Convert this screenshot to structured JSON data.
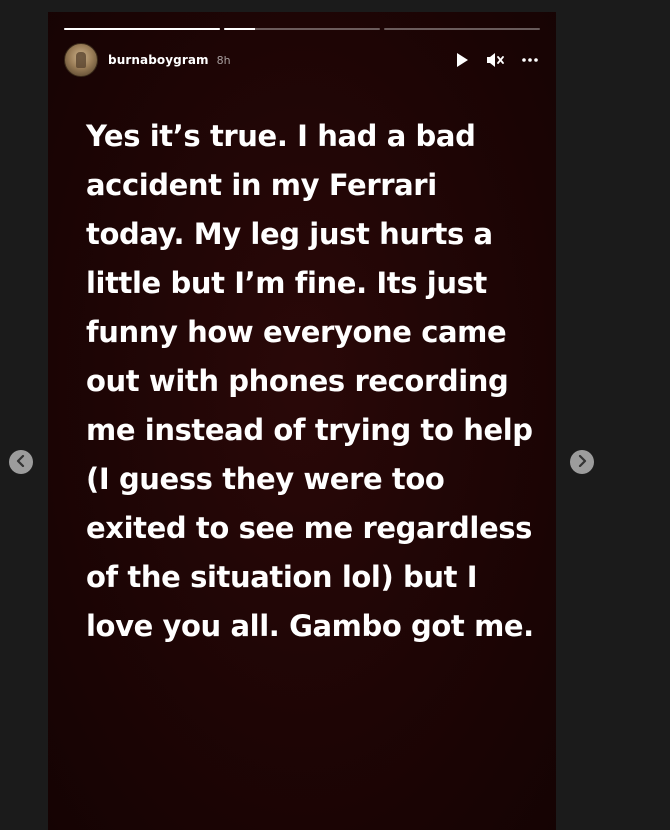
{
  "progress": [
    1.0,
    0.2,
    0.0
  ],
  "header": {
    "username": "burnaboygram",
    "time": "8h"
  },
  "controls": {
    "play_icon": "play-icon",
    "mute_icon": "muted-speaker-icon",
    "more_icon": "more-dots-icon"
  },
  "story": {
    "text": "Yes it’s true. I had a bad accident in my Ferrari today. My leg just hurts a little but I’m fine. Its just funny how everyone came out with phones recording me instead of trying to help (I guess they were too exited to see me regardless of the situation lol)  but I love you all. Gambo got me."
  },
  "nav": {
    "prev_icon": "chevron-left-icon",
    "next_icon": "chevron-right-icon"
  },
  "colors": {
    "story_background": "#1e0505",
    "page_background": "#1b1b1b",
    "text": "#ffffff"
  }
}
